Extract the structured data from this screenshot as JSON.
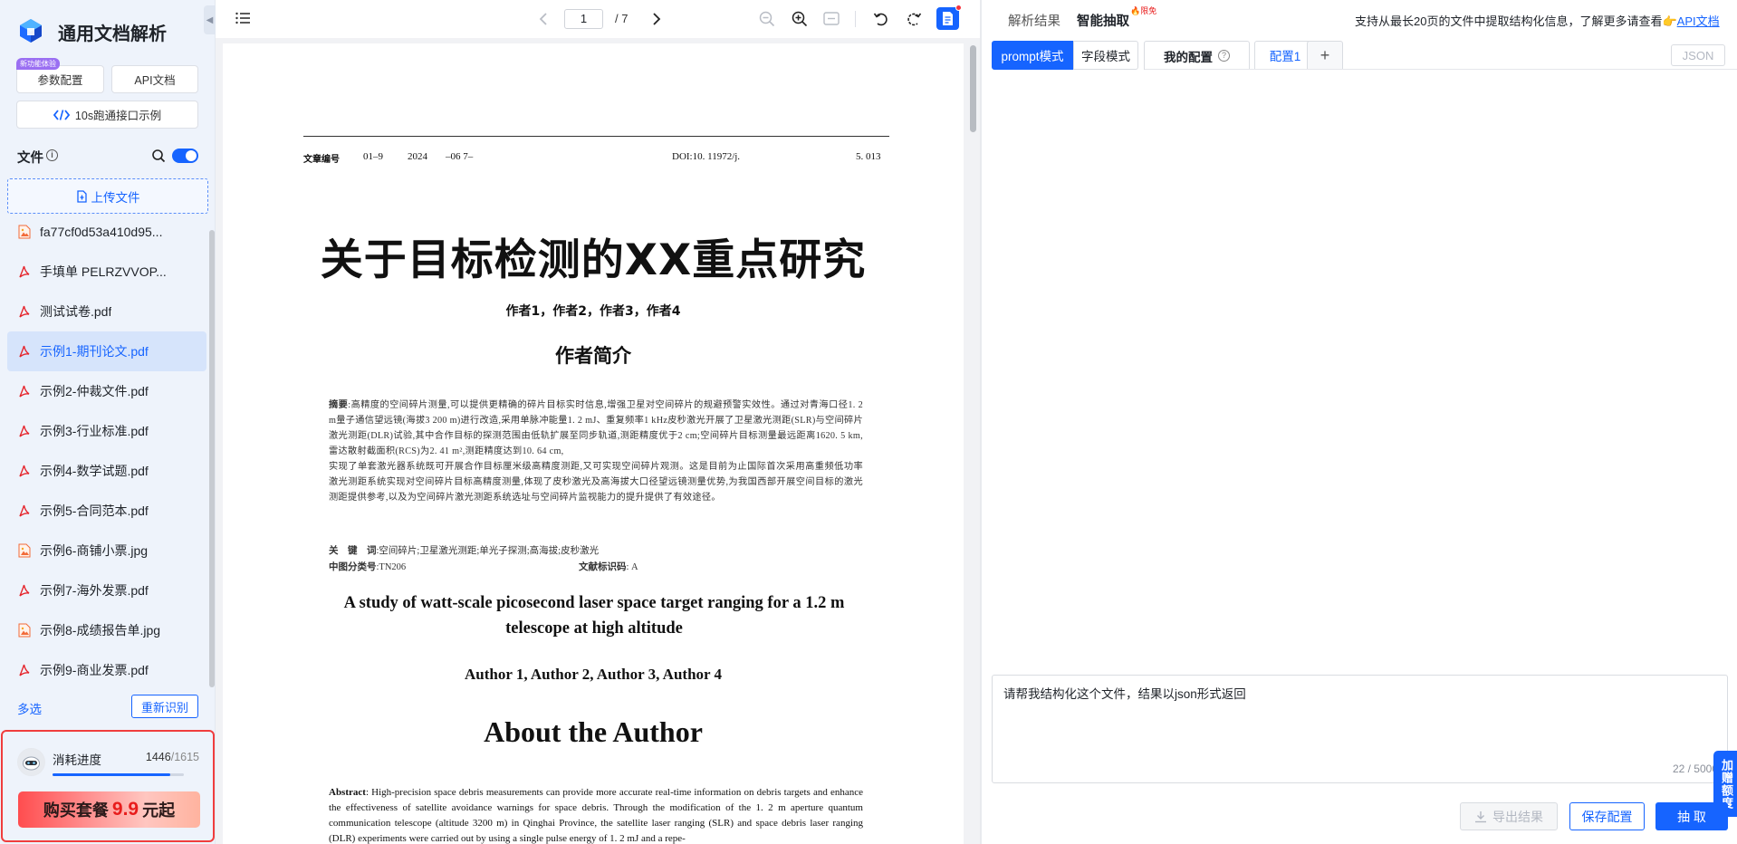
{
  "sidebar": {
    "title": "通用文档解析",
    "new_badge": "新功能体验",
    "param_button": "参数配置",
    "api_button": "API文档",
    "example_button": "10s跑通接口示例",
    "files_label": "文件",
    "upload_label": "上传文件",
    "files": [
      {
        "name": "fa77cf0d53a410d95...",
        "type": "image",
        "active": false
      },
      {
        "name": "手填单 PELRZVVOP...",
        "type": "pdf",
        "active": false
      },
      {
        "name": "测试试卷.pdf",
        "type": "pdf",
        "active": false
      },
      {
        "name": "示例1-期刊论文.pdf",
        "type": "pdf",
        "active": true
      },
      {
        "name": "示例2-仲裁文件.pdf",
        "type": "pdf",
        "active": false
      },
      {
        "name": "示例3-行业标准.pdf",
        "type": "pdf",
        "active": false
      },
      {
        "name": "示例4-数学试题.pdf",
        "type": "pdf",
        "active": false
      },
      {
        "name": "示例5-合同范本.pdf",
        "type": "pdf",
        "active": false
      },
      {
        "name": "示例6-商铺小票.jpg",
        "type": "image",
        "active": false
      },
      {
        "name": "示例7-海外发票.pdf",
        "type": "pdf",
        "active": false
      },
      {
        "name": "示例8-成绩报告单.jpg",
        "type": "image",
        "active": false
      },
      {
        "name": "示例9-商业发票.pdf",
        "type": "pdf",
        "active": false
      }
    ],
    "multi_select": "多选",
    "rerecognize": "重新识别",
    "usage": {
      "label": "消耗进度",
      "used": "1446",
      "total": "/1615",
      "fraction": 0.895
    },
    "buy": {
      "prefix": "购买套餐",
      "price": "9.9",
      "suffix": "元起"
    }
  },
  "viewer": {
    "page_current": "1",
    "page_total": "/ 7",
    "document": {
      "header": {
        "label": "文章编号",
        "code": "01–9",
        "year": "2024",
        "month": "–06 7–",
        "doi": "DOI:10. 11972/j.",
        "num": "5. 013"
      },
      "title": "关于目标检测的XX重点研究",
      "authors": "作者1，作者2，作者3，作者4",
      "intro_heading": "作者简介",
      "abstract_label": "摘要",
      "abstract_p1": ":高精度的空间碎片测量,可以提供更精确的碎片目标实时信息,增强卫星对空间碎片的规避预警实效性。通过对青海口径1. 2 m量子通信望远镜(海拔3 200 m)进行改造,采用单脉冲能量1. 2 mJ、重复频率1 kHz皮秒激光开展了卫星激光测距(SLR)与空间碎片激光测距(DLR)试验,其中合作目标的探测范围由低轨扩展至同步轨道,测距精度优于2 cm;空间碎片目标测量最远距离1620. 5 km,雷达散射截面积(RCS)为2. 41 m²,测距精度达到10. 64 cm,",
      "abstract_p2": "实现了单套激光器系统既可开展合作目标厘米级高精度测距,又可实现空间碎片观测。这是目前为止国际首次采用高重频低功率激光测距系统实现对空间碎片目标高精度测量,体现了皮秒激光及高海拔大口径望远镜测量优势,为我国西部开展空间目标的激光测距提供参考,以及为空间碎片激光测距系统选址与空间碎片监视能力的提升提供了有效途径。",
      "keywords_label": "关　键　词",
      "keywords": ":空间碎片;卫星激光测距;单光子探测;高海拔;皮秒激光",
      "class_label": "中图分类号",
      "class_value": ":TN206",
      "code_label": "文献标识码",
      "code_value": ": A",
      "en_title": "A study of watt-scale picosecond laser space target ranging for a 1.2 m telescope at high altitude",
      "en_authors": "Author 1, Author 2, Author 3, Author 4",
      "en_about": "About the Author",
      "en_abstract_label": "Abstract",
      "en_abstract": ": High-precision space debris measurements can provide more accurate real-time information on debris targets and enhance the effectiveness of satellite avoidance warnings for space debris. Through the modification of the 1. 2 m aperture quantum communication telescope (altitude 3200 m) in Qinghai Province, the satellite laser ranging (SLR) and space debris laser ranging (DLR) experiments were carried out by using a single pulse energy of 1. 2 mJ and a repe-"
    }
  },
  "right": {
    "tab_result": "解析结果",
    "tab_extract": "智能抽取",
    "hot_badge": "🔥限免",
    "notice": "支持从最长20页的文件中提取结构化信息，了解更多请查看👉",
    "notice_link": "API文档",
    "mode_prompt": "prompt模式",
    "mode_field": "字段模式",
    "my_config": "我的配置",
    "config_tab": "配置1",
    "json_btn": "JSON",
    "prompt_text": "请帮我结构化这个文件，结果以json形式返回",
    "prompt_count": "22 / 5000",
    "bonus": "加赠额度",
    "export_btn": "导出结果",
    "save_btn": "保存配置",
    "extract_btn": "抽 取"
  }
}
